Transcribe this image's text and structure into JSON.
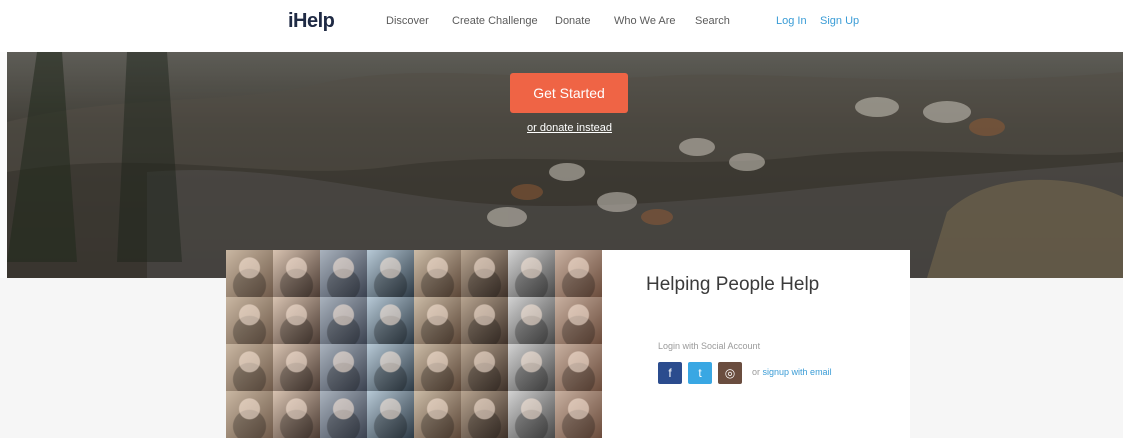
{
  "header": {
    "logo": "iHelp",
    "nav": [
      "Discover",
      "Create Challenge",
      "Donate",
      "Who We Are",
      "Search"
    ],
    "auth": {
      "login": "Log In",
      "signup": "Sign Up"
    }
  },
  "hero": {
    "cta": "Get Started",
    "alt_link": "or donate instead"
  },
  "panel": {
    "title": "Helping People Help",
    "login_label": "Login with Social Account",
    "or": "or",
    "signup_email": "signup with email",
    "social_icons": [
      "facebook-icon",
      "twitter-icon",
      "instagram-icon"
    ]
  },
  "colors": {
    "accent": "#ef6445",
    "link_blue": "#3a9cd6",
    "facebook": "#2b4c8e",
    "twitter": "#39a7e3",
    "instagram": "#6a4d3f"
  }
}
